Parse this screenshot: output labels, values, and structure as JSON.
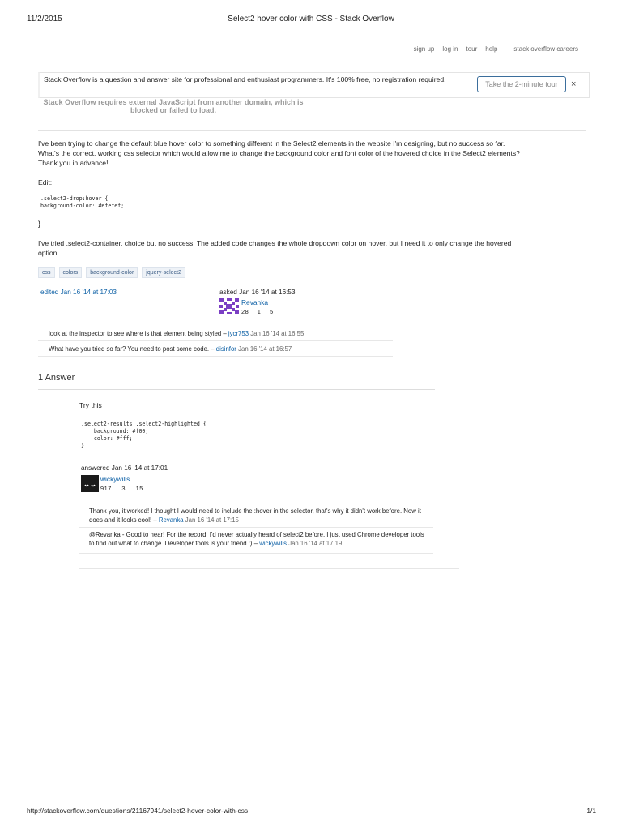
{
  "print_header": {
    "date": "11/2/2015",
    "title": "Select2 hover color with CSS - Stack Overflow"
  },
  "topnav": {
    "items": [
      "sign up",
      "log in",
      "tour",
      "help"
    ],
    "careers": "stack overflow careers"
  },
  "hero": {
    "text": "Stack Overflow is a question and answer site for professional and enthusiast programmers. It's 100% free, no registration required.",
    "tour_button": "Take the 2-minute tour",
    "close": "×"
  },
  "js_warning": "Stack Overflow requires external JavaScript from another domain, which is blocked or failed to load.",
  "question": {
    "paragraph1": "I've been trying to change the default blue hover color to something different in the Select2 elements in the website I'm designing, but no success so far. What's the correct, working css selector which would allow me to change the background color and font color of the hovered choice in the Select2 elements? Thank you in advance!",
    "edit_label": "Edit:",
    "code": ".select2-drop:hover {\nbackground-color: #efefef;",
    "closing_brace": "}",
    "paragraph2": "I've tried .select2-container, choice but no success. The added code changes the whole dropdown color on hover, but I need it to only change the hovered option.",
    "tags": [
      "css",
      "colors",
      "background-color",
      "jquery-select2"
    ],
    "edited": "edited Jan 16 '14 at 17:03",
    "asked": "asked Jan 16 '14 at 16:53",
    "asker": {
      "name": "Revanka",
      "rep": "28",
      "silver": "1",
      "bronze": "5"
    }
  },
  "question_comments": [
    {
      "text": "look at the inspector to see where is that element being styled –",
      "user": "jycr753",
      "date": "Jan 16 '14 at 16:55"
    },
    {
      "text": "What have you tried so far? You need to post some code. –",
      "user": "disinfor",
      "date": "Jan 16 '14 at 16:57"
    }
  ],
  "answers_heading": "1 Answer",
  "answer": {
    "intro": "Try this",
    "code": ".select2-results .select2-highlighted {\n    background: #f00;\n    color: #fff;\n}",
    "answered": "answered Jan 16 '14 at 17:01",
    "answerer": {
      "name": "wickywills",
      "rep": "917",
      "silver": "3",
      "bronze": "15"
    }
  },
  "answer_comments": [
    {
      "text": "Thank you, it worked! I thought I would need to include the :hover in the selector, that's why it didn't work before. Now it does and it looks cool! –",
      "user": "Revanka",
      "date": "Jan 16 '14 at 17:15"
    },
    {
      "text": "@Revanka - Good to hear! For the record, I'd never actually heard of select2 before, I just used Chrome developer tools to find out what to change. Developer tools is your friend :) –",
      "user": "wickywills",
      "date": "Jan 16 '14 at 17:19"
    }
  ],
  "footer": {
    "url": "http://stackoverflow.com/questions/21167941/select2-hover-color-with-css",
    "page": "1/1"
  },
  "colors": {
    "link": "#0b5fa5",
    "tour_border": "#3b6e9c",
    "tag_bg": "#eef2f7",
    "gravatar_purple": "#7b3fc4"
  }
}
